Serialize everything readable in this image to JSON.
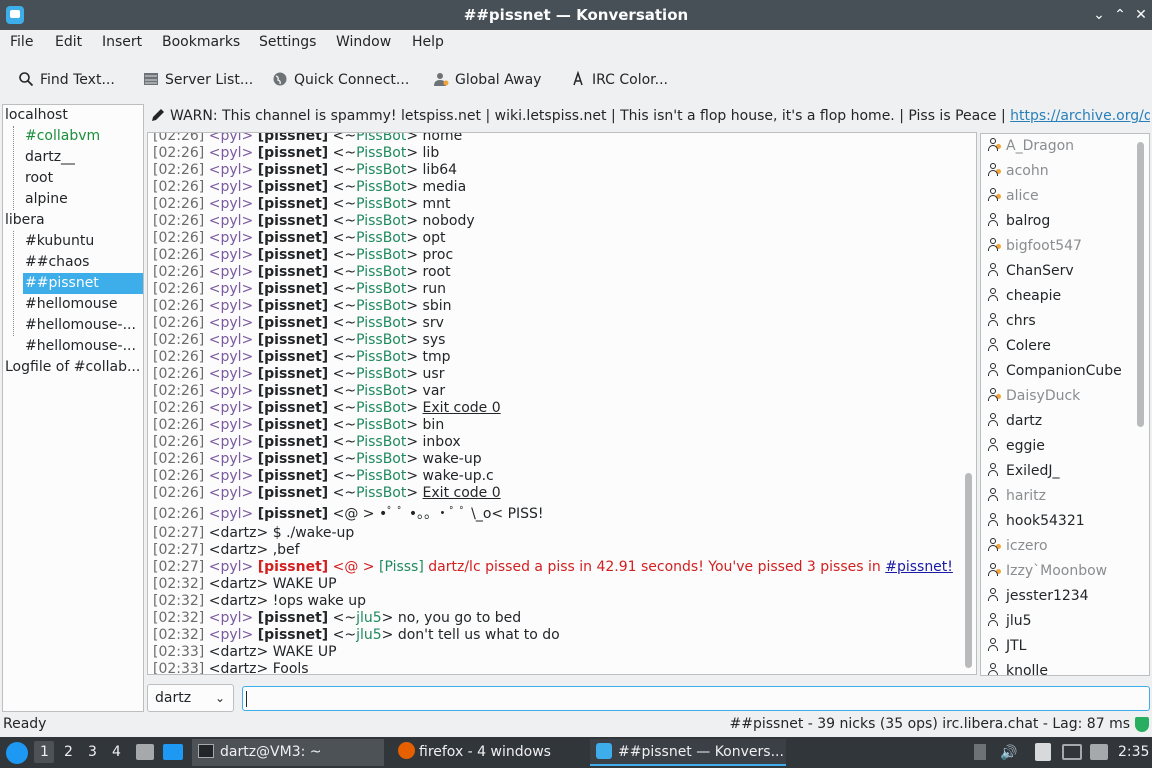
{
  "window": {
    "title": "##pissnet — Konversation"
  },
  "menu": [
    "File",
    "Edit",
    "Insert",
    "Bookmarks",
    "Settings",
    "Window",
    "Help"
  ],
  "toolbar": {
    "find": "Find Text...",
    "server_list": "Server List...",
    "quick_connect": "Quick Connect...",
    "global_away": "Global Away",
    "irc_color": "IRC Color..."
  },
  "tree": {
    "items": [
      {
        "label": "localhost"
      },
      {
        "label": "#collabvm"
      },
      {
        "label": "dartz__"
      },
      {
        "label": "root"
      },
      {
        "label": "alpine"
      },
      {
        "label": "libera"
      },
      {
        "label": "#kubuntu"
      },
      {
        "label": "##chaos"
      },
      {
        "label": "##pissnet"
      },
      {
        "label": "#hellomouse"
      },
      {
        "label": "#hellomouse-..."
      },
      {
        "label": "#hellomouse-..."
      },
      {
        "label": "Logfile of #collab..."
      }
    ]
  },
  "topic": {
    "text": "WARN: This channel is spammy! letspiss.net | wiki.letspiss.net | This isn't a flop house, it's a flop home. | Piss is Peace | ",
    "link": "https://archive.org/det..."
  },
  "chat": {
    "bot_lines": [
      {
        "ts": "[02:26]",
        "nick": "<pyl>",
        "tag": "[pissnet]",
        "pre": "<~",
        "who": "PissBot",
        "post": "> ",
        "msg": "home"
      },
      {
        "ts": "[02:26]",
        "nick": "<pyl>",
        "tag": "[pissnet]",
        "pre": "<~",
        "who": "PissBot",
        "post": "> ",
        "msg": "lib"
      },
      {
        "ts": "[02:26]",
        "nick": "<pyl>",
        "tag": "[pissnet]",
        "pre": "<~",
        "who": "PissBot",
        "post": "> ",
        "msg": "lib64"
      },
      {
        "ts": "[02:26]",
        "nick": "<pyl>",
        "tag": "[pissnet]",
        "pre": "<~",
        "who": "PissBot",
        "post": "> ",
        "msg": "media"
      },
      {
        "ts": "[02:26]",
        "nick": "<pyl>",
        "tag": "[pissnet]",
        "pre": "<~",
        "who": "PissBot",
        "post": "> ",
        "msg": "mnt"
      },
      {
        "ts": "[02:26]",
        "nick": "<pyl>",
        "tag": "[pissnet]",
        "pre": "<~",
        "who": "PissBot",
        "post": "> ",
        "msg": "nobody"
      },
      {
        "ts": "[02:26]",
        "nick": "<pyl>",
        "tag": "[pissnet]",
        "pre": "<~",
        "who": "PissBot",
        "post": "> ",
        "msg": "opt"
      },
      {
        "ts": "[02:26]",
        "nick": "<pyl>",
        "tag": "[pissnet]",
        "pre": "<~",
        "who": "PissBot",
        "post": "> ",
        "msg": "proc"
      },
      {
        "ts": "[02:26]",
        "nick": "<pyl>",
        "tag": "[pissnet]",
        "pre": "<~",
        "who": "PissBot",
        "post": "> ",
        "msg": "root"
      },
      {
        "ts": "[02:26]",
        "nick": "<pyl>",
        "tag": "[pissnet]",
        "pre": "<~",
        "who": "PissBot",
        "post": "> ",
        "msg": "run"
      },
      {
        "ts": "[02:26]",
        "nick": "<pyl>",
        "tag": "[pissnet]",
        "pre": "<~",
        "who": "PissBot",
        "post": "> ",
        "msg": "sbin"
      },
      {
        "ts": "[02:26]",
        "nick": "<pyl>",
        "tag": "[pissnet]",
        "pre": "<~",
        "who": "PissBot",
        "post": "> ",
        "msg": "srv"
      },
      {
        "ts": "[02:26]",
        "nick": "<pyl>",
        "tag": "[pissnet]",
        "pre": "<~",
        "who": "PissBot",
        "post": "> ",
        "msg": "sys"
      },
      {
        "ts": "[02:26]",
        "nick": "<pyl>",
        "tag": "[pissnet]",
        "pre": "<~",
        "who": "PissBot",
        "post": "> ",
        "msg": "tmp"
      },
      {
        "ts": "[02:26]",
        "nick": "<pyl>",
        "tag": "[pissnet]",
        "pre": "<~",
        "who": "PissBot",
        "post": "> ",
        "msg": "usr"
      },
      {
        "ts": "[02:26]",
        "nick": "<pyl>",
        "tag": "[pissnet]",
        "pre": "<~",
        "who": "PissBot",
        "post": "> ",
        "msg": "var"
      },
      {
        "ts": "[02:26]",
        "nick": "<pyl>",
        "tag": "[pissnet]",
        "pre": "<~",
        "who": "PissBot",
        "post": "> ",
        "msg": "Exit code 0",
        "underline": true
      },
      {
        "ts": "[02:26]",
        "nick": "<pyl>",
        "tag": "[pissnet]",
        "pre": "<~",
        "who": "PissBot",
        "post": "> ",
        "msg": "bin"
      },
      {
        "ts": "[02:26]",
        "nick": "<pyl>",
        "tag": "[pissnet]",
        "pre": "<~",
        "who": "PissBot",
        "post": "> ",
        "msg": "inbox"
      },
      {
        "ts": "[02:26]",
        "nick": "<pyl>",
        "tag": "[pissnet]",
        "pre": "<~",
        "who": "PissBot",
        "post": "> ",
        "msg": "wake-up"
      },
      {
        "ts": "[02:26]",
        "nick": "<pyl>",
        "tag": "[pissnet]",
        "pre": "<~",
        "who": "PissBot",
        "post": "> ",
        "msg": "wake-up.c"
      },
      {
        "ts": "[02:26]",
        "nick": "<pyl>",
        "tag": "[pissnet]",
        "pre": "<~",
        "who": "PissBot",
        "post": "> ",
        "msg": "Exit code 0",
        "underline": true
      }
    ],
    "piss_art": {
      "ts": "[02:26]",
      "nick": "<pyl>",
      "tag": "[pissnet]",
      "msg": "<@  >  •ﾟ ﾟ  •｡｡ •ﾟ ﾟ  \\_o< PISS!"
    },
    "lines": [
      {
        "ts": "[02:27]",
        "text": "<dartz> $ ./wake-up"
      },
      {
        "ts": "[02:27]",
        "text": "<dartz> ,bef"
      }
    ],
    "highlight": {
      "ts": "[02:27]",
      "nick": "<pyl>",
      "tag": "[pissnet]",
      "a": "<@  >",
      "b": "[Pisss]",
      "c": "dartz/lc pissed a piss in 42.91 seconds! You've pissed 3 pisses in",
      "link": "#pissnet!"
    },
    "lines2": [
      {
        "ts": "[02:32]",
        "text": "<dartz> WAKE UP"
      },
      {
        "ts": "[02:32]",
        "text": "<dartz> !ops wake up"
      }
    ],
    "jlu5": [
      {
        "ts": "[02:32]",
        "nick": "<pyl>",
        "tag": "[pissnet]",
        "pre": "<~",
        "who": "jlu5",
        "post": "> ",
        "msg": "no, you go to bed"
      },
      {
        "ts": "[02:32]",
        "nick": "<pyl>",
        "tag": "[pissnet]",
        "pre": "<~",
        "who": "jlu5",
        "post": "> ",
        "msg": "don't tell us what to do"
      }
    ],
    "lines3": [
      {
        "ts": "[02:33]",
        "text": "<dartz> WAKE UP"
      },
      {
        "ts": "[02:33]",
        "text": "<dartz> Fools"
      }
    ]
  },
  "nicks": [
    {
      "name": "A_Dragon",
      "away": true,
      "op": true
    },
    {
      "name": "acohn",
      "away": true,
      "op": true
    },
    {
      "name": "alice",
      "away": true,
      "op": true
    },
    {
      "name": "balrog",
      "away": false,
      "op": false
    },
    {
      "name": "bigfoot547",
      "away": true,
      "op": true
    },
    {
      "name": "ChanServ",
      "away": false,
      "op": false
    },
    {
      "name": "cheapie",
      "away": false,
      "op": false
    },
    {
      "name": "chrs",
      "away": false,
      "op": false
    },
    {
      "name": "Colere",
      "away": false,
      "op": false
    },
    {
      "name": "CompanionCube",
      "away": false,
      "op": false
    },
    {
      "name": "DaisyDuck",
      "away": true,
      "op": true
    },
    {
      "name": "dartz",
      "away": false,
      "op": false
    },
    {
      "name": "eggie",
      "away": false,
      "op": false
    },
    {
      "name": "ExiledJ_",
      "away": false,
      "op": false
    },
    {
      "name": "haritz",
      "away": true,
      "op": false
    },
    {
      "name": "hook54321",
      "away": false,
      "op": false
    },
    {
      "name": "iczero",
      "away": true,
      "op": true
    },
    {
      "name": "Izzy`Moonbow",
      "away": true,
      "op": true
    },
    {
      "name": "jesster1234",
      "away": false,
      "op": false
    },
    {
      "name": "jlu5",
      "away": false,
      "op": false
    },
    {
      "name": "JTL",
      "away": false,
      "op": false
    },
    {
      "name": "knolle",
      "away": false,
      "op": false
    }
  ],
  "input": {
    "nick": "dartz",
    "value": ""
  },
  "status": {
    "left": "Ready",
    "right": "##pissnet - 39 nicks (35 ops)  irc.libera.chat - Lag: 87 ms"
  },
  "taskbar": {
    "desktops": [
      "1",
      "2",
      "3",
      "4"
    ],
    "tasks": [
      "dartz@VM3: ~",
      "firefox - 4 windows",
      "##pissnet — Konvers..."
    ],
    "clock": "2:35"
  }
}
